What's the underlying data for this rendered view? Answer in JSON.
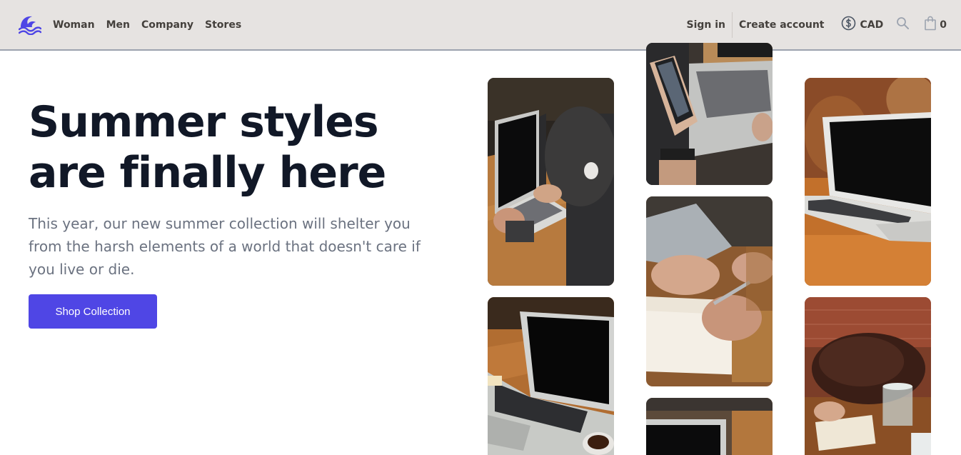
{
  "header": {
    "nav_left": [
      {
        "label": "Woman"
      },
      {
        "label": "Men"
      },
      {
        "label": "Company"
      },
      {
        "label": "Stores"
      }
    ],
    "sign_in": "Sign in",
    "create_account": "Create account",
    "currency": "CAD",
    "cart_count": "0"
  },
  "hero": {
    "headline_line1": "Summer styles",
    "headline_line2": "are finally here",
    "subtext": "This year, our new summer collection will shelter you from the harsh elements of a world that doesn't care if you live or die.",
    "cta_label": "Shop Collection"
  },
  "colors": {
    "accent": "#4f46e5",
    "header_bg": "#e6e3e1",
    "headline": "#111827",
    "subtext": "#6b7280"
  },
  "gallery": {
    "tiles": [
      {
        "subject": "person typing on laptop at wooden table"
      },
      {
        "subject": "laptop on wooden table with coffee cup"
      },
      {
        "subject": "hand holding phone over laptop"
      },
      {
        "subject": "hand writing in notebook with pen"
      },
      {
        "subject": "laptop on table"
      },
      {
        "subject": "open laptop on wooden cafe table"
      },
      {
        "subject": "leather bag, glass of water and notebook on table"
      }
    ]
  }
}
